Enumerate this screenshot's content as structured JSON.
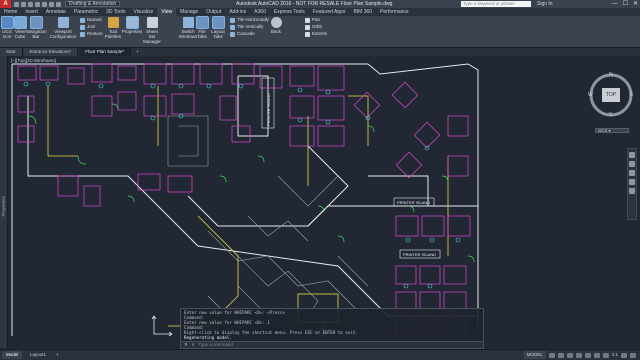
{
  "titlebar": {
    "logo": "A",
    "workspace": "Drafting & Annotation",
    "title": "Autodesk AutoCAD 2016 - NOT FOR RESALE    Floor Plan Sample.dwg",
    "search_placeholder": "Type a keyword or phrase",
    "sign_in": "Sign In",
    "window_controls": [
      "—",
      "☐",
      "✕"
    ]
  },
  "ribbon_tabs": [
    "Home",
    "Insert",
    "Annotate",
    "Parametric",
    "3D Tools",
    "Visualize",
    "View",
    "Manage",
    "Output",
    "Add-ins",
    "A360",
    "Express Tools",
    "Featured Apps",
    "BIM 360",
    "Performance"
  ],
  "active_ribbon_tab": "View",
  "ribbon": {
    "buttons": {
      "ucs_icon": "UCS Icon",
      "view_cube": "View Cube",
      "navigation_bar": "Navigation Bar",
      "viewport_configuration": "Viewport Configuration",
      "named": "Named",
      "join": "Join",
      "restore": "Restore",
      "tool_palettes": "Tool Palettes",
      "properties": "Properties",
      "sheet_set_manager": "Sheet Set Manager",
      "file_tabs": "File Tabs",
      "layout_tabs": "Layout Tabs",
      "tile_horizontally": "Tile Horizontally",
      "tile_vertically": "Tile Vertically",
      "cascade": "Cascade",
      "switch_windows": "Switch Windows",
      "back": "Back",
      "pan": "Pan",
      "orbit": "Orbit",
      "extents": "Extents"
    },
    "panels": [
      "Viewport Tools",
      "Model Viewports",
      "Palettes",
      "Interface",
      "Navigate"
    ]
  },
  "file_tabs": [
    "Start",
    "Entrance Elevations*",
    "Floor Plan Sample*"
  ],
  "active_file_tab": "Floor Plan Sample*",
  "left_palette_label": "Properties",
  "viewport_label": "[–][Top][2D Wireframe]",
  "drawing_labels": {
    "printer_island_vertical": "PRINTER ISLAND",
    "printer_island_a": "PRINTER ISLAND",
    "printer_island_b": "PRINTER ISLAND"
  },
  "viewcube": {
    "face": "TOP",
    "north": "N",
    "south": "S",
    "east": "E",
    "west": "W",
    "wcs": "WCS ▾"
  },
  "command_history": [
    "Enter new value for WHIPARC <0>: <Press>",
    "Command:",
    "Enter new value for WHIPARC <0>: 1",
    "Command:",
    "Right-click to display the shortcut menu. Press ESC or ENTER to exit.",
    "Regenerating model."
  ],
  "command_prompt": "Type a command",
  "status_tabs": [
    "Model",
    "Layout1",
    "+"
  ],
  "active_status_tab": "Model",
  "status_right": {
    "model": "MODEL",
    "scale": "1:1"
  },
  "colors": {
    "background": "#212833",
    "wall_yellow": "#e7de45",
    "furniture_magenta": "#e045d6",
    "door_green": "#3fdc59",
    "cyan": "#4fd8e8",
    "white_lines": "#e6e9ee",
    "red": "#e84b4b"
  }
}
